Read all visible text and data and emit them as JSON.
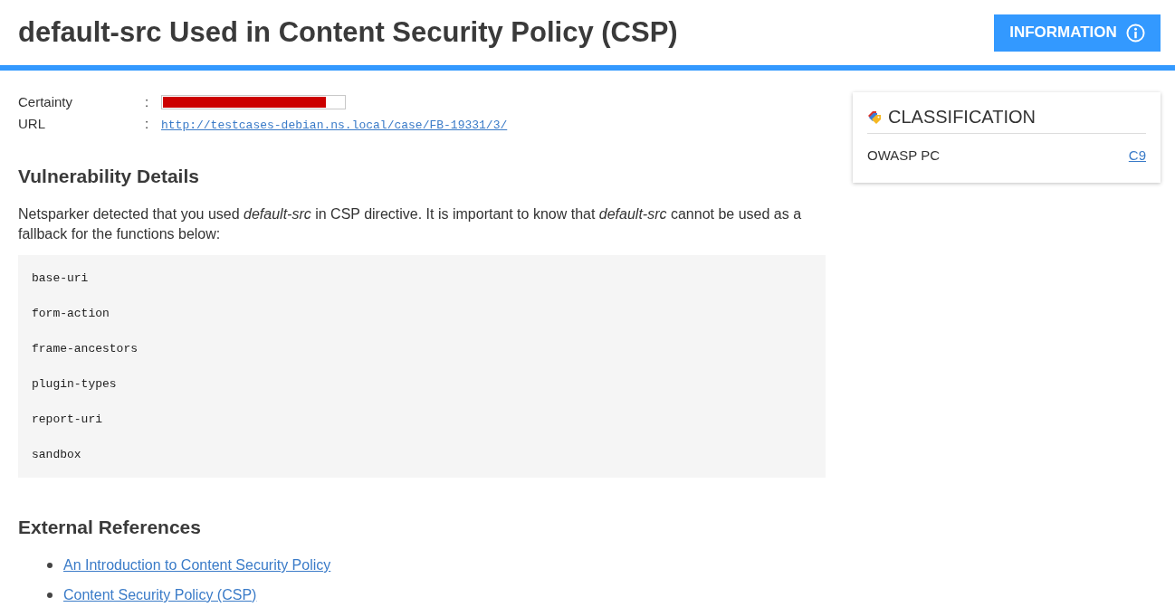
{
  "header": {
    "title": "default-src Used in Content Security Policy (CSP)",
    "badge": {
      "label": "INFORMATION"
    }
  },
  "meta": [
    {
      "kind": "meter",
      "label": "Certainty",
      "separator": ":",
      "level": 0.9
    },
    {
      "kind": "link",
      "label": "URL",
      "separator": ":",
      "value": "http://testcases-debian.ns.local/case/FB-19331/3/"
    }
  ],
  "details": {
    "heading": "Vulnerability Details",
    "paragraph": "Netsparker detected that you used *default-src* in CSP directive. It is important to know that *default-src* cannot be used as a fallback for the functions below:",
    "code_lines": [
      "base-uri",
      "form-action",
      "frame-ancestors",
      "plugin-types",
      "report-uri",
      "sandbox"
    ]
  },
  "references": {
    "heading": "External References",
    "links": [
      "An Introduction to Content Security Policy",
      "Content Security Policy (CSP)"
    ]
  },
  "classification": {
    "title": "CLASSIFICATION",
    "rows": [
      {
        "label": "OWASP PC",
        "value": "C9"
      }
    ]
  }
}
